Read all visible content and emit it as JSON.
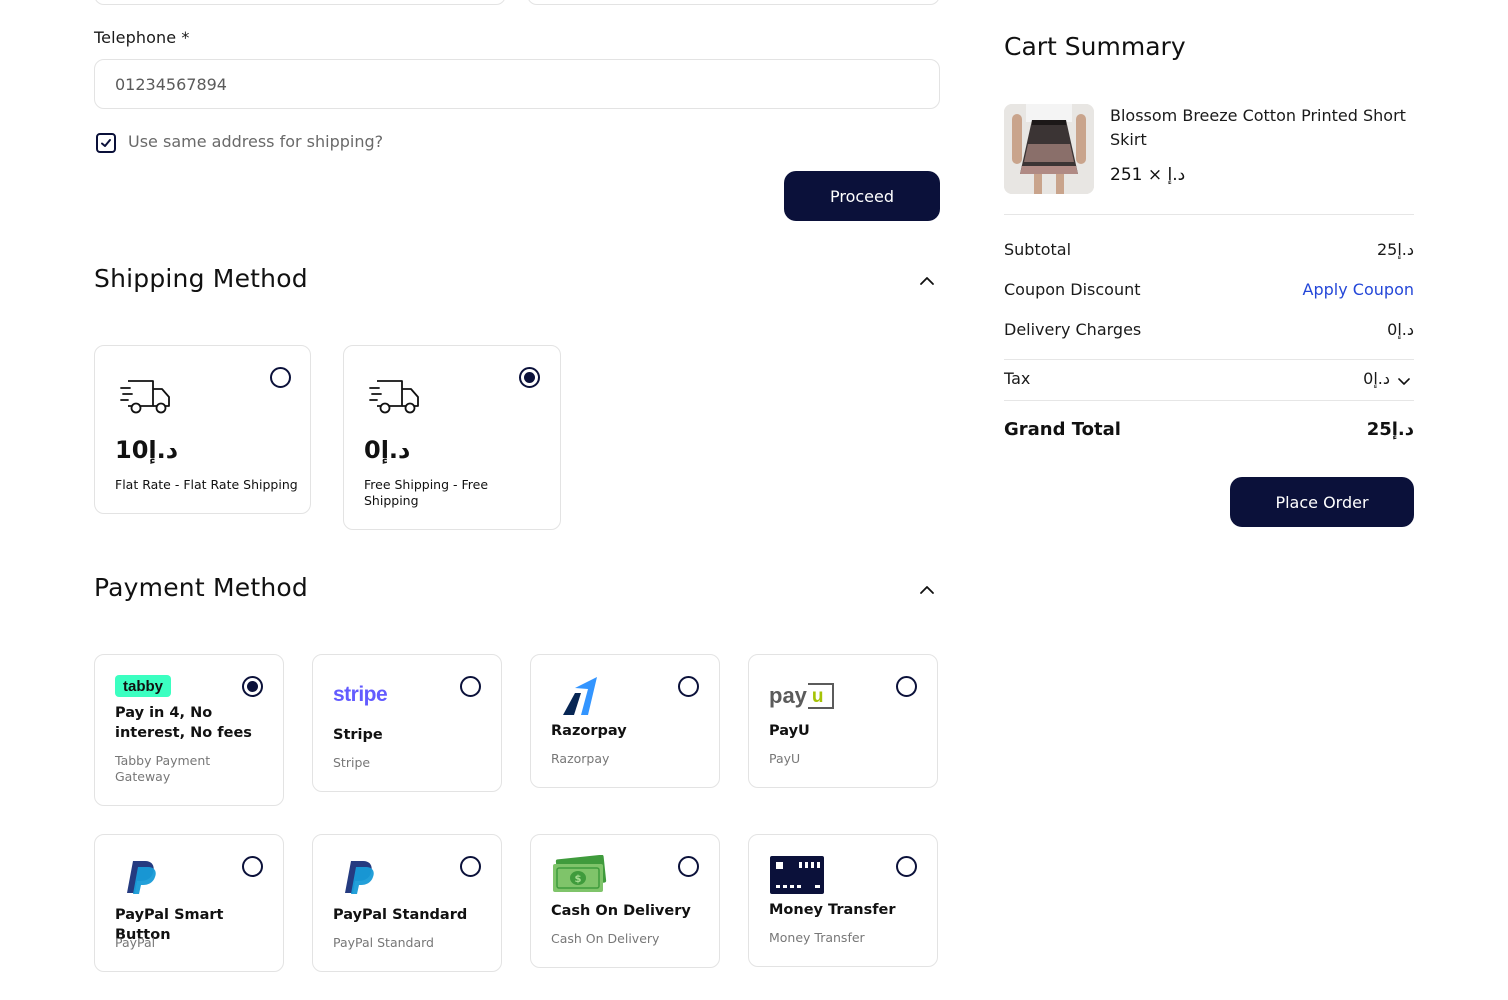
{
  "billing": {
    "telephone_label": "Telephone *",
    "telephone_value": "01234567894",
    "same_address_label": "Use same address for shipping?",
    "same_address_checked": true,
    "proceed_label": "Proceed"
  },
  "shipping": {
    "title": "Shipping Method",
    "options": [
      {
        "price": "10د.إ",
        "name": "Flat Rate - Flat Rate Shipping",
        "selected": false,
        "icon": "truck-icon"
      },
      {
        "price": "0د.إ",
        "name": "Free Shipping - Free Shipping",
        "selected": true,
        "icon": "truck-icon"
      }
    ]
  },
  "payment": {
    "title": "Payment Method",
    "options": [
      {
        "logo": "tabby",
        "title": "Pay in 4, No interest, No fees",
        "sub": "Tabby Payment Gateway",
        "selected": true
      },
      {
        "logo": "stripe",
        "title": "Stripe",
        "sub": "Stripe",
        "selected": false
      },
      {
        "logo": "razorpay-icon",
        "title": "Razorpay",
        "sub": "Razorpay",
        "selected": false
      },
      {
        "logo": "payu",
        "title": "PayU",
        "sub": "PayU",
        "selected": false
      },
      {
        "logo": "paypal-icon",
        "title": "PayPal Smart Button",
        "sub": "PayPal",
        "selected": false
      },
      {
        "logo": "paypal-icon",
        "title": "PayPal Standard",
        "sub": "PayPal Standard",
        "selected": false
      },
      {
        "logo": "cash-icon",
        "title": "Cash On Delivery",
        "sub": "Cash On Delivery",
        "selected": false
      },
      {
        "logo": "bank-card-icon",
        "title": "Money Transfer",
        "sub": "Money Transfer",
        "selected": false
      }
    ]
  },
  "cart": {
    "title": "Cart Summary",
    "item": {
      "name": "Blossom Breeze Cotton Printed Short Skirt",
      "price_qty": "251 × د.إ"
    },
    "subtotal_label": "Subtotal",
    "subtotal_value": "25د.إ",
    "coupon_label": "Coupon Discount",
    "coupon_link": "Apply Coupon",
    "delivery_label": "Delivery Charges",
    "delivery_value": "0د.إ",
    "tax_label": "Tax",
    "tax_value": "0د.إ",
    "grand_total_label": "Grand Total",
    "grand_total_value": "25د.إ",
    "place_order_label": "Place Order"
  },
  "colors": {
    "primary": "#0b113a",
    "link": "#2447d8",
    "tabby_green": "#3bffc1",
    "stripe_purple": "#635bff",
    "paypal_dark": "#253b80",
    "paypal_light": "#179bd7",
    "razorpay_blue": "#3395ff",
    "payu_green": "#a6c307"
  }
}
